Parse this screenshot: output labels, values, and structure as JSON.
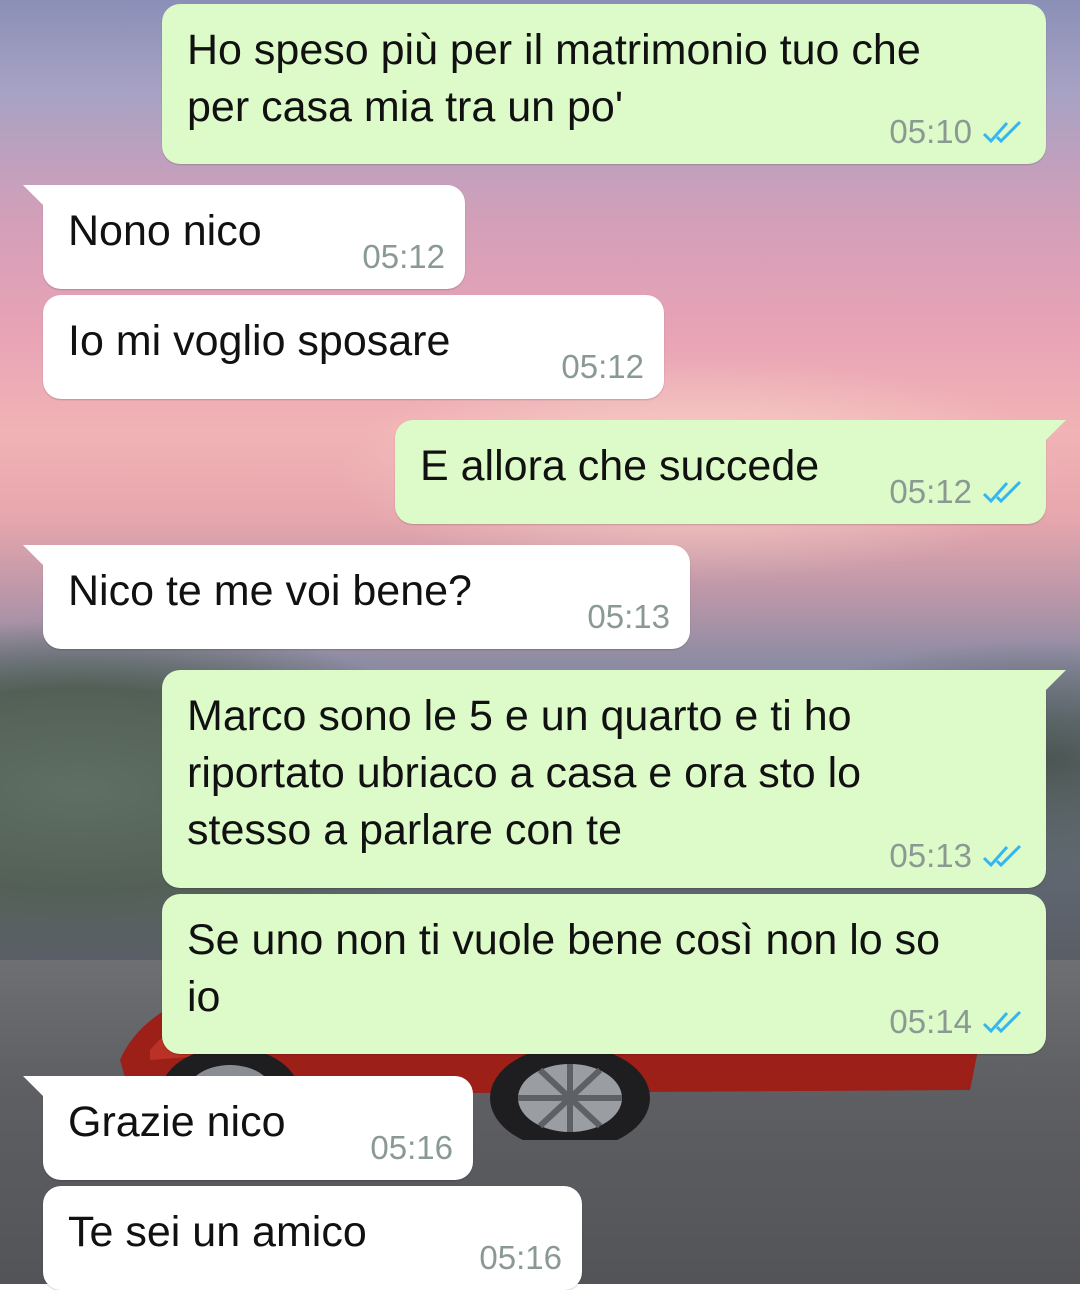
{
  "colors": {
    "outgoing_bubble": "#ddfac9",
    "incoming_bubble": "#ffffff",
    "timestamp": "#8a9a93",
    "read_ticks": "#34b7f1"
  },
  "messages": [
    {
      "direction": "out",
      "text": "Ho speso più per il matrimonio tuo che\nper casa mia tra un po'",
      "time": "05:10",
      "status": "read",
      "status_icon": "double-check-icon"
    },
    {
      "direction": "in",
      "text": "Nono nico",
      "time": "05:12"
    },
    {
      "direction": "in",
      "text": "Io mi voglio sposare",
      "time": "05:12"
    },
    {
      "direction": "out",
      "text": "E allora che succede",
      "time": "05:12",
      "status": "read",
      "status_icon": "double-check-icon"
    },
    {
      "direction": "in",
      "text": "Nico te me voi bene?",
      "time": "05:13"
    },
    {
      "direction": "out",
      "text": "Marco sono le 5 e un quarto e ti ho\nriportato ubriaco a casa e ora sto lo\nstesso a parlare con te",
      "time": "05:13",
      "status": "read",
      "status_icon": "double-check-icon"
    },
    {
      "direction": "out",
      "text": "Se uno non ti vuole bene così non lo so\nio",
      "time": "05:14",
      "status": "read",
      "status_icon": "double-check-icon"
    },
    {
      "direction": "in",
      "text": "Grazie nico",
      "time": "05:16"
    },
    {
      "direction": "in",
      "text": "Te sei un amico",
      "time": "05:16"
    }
  ]
}
